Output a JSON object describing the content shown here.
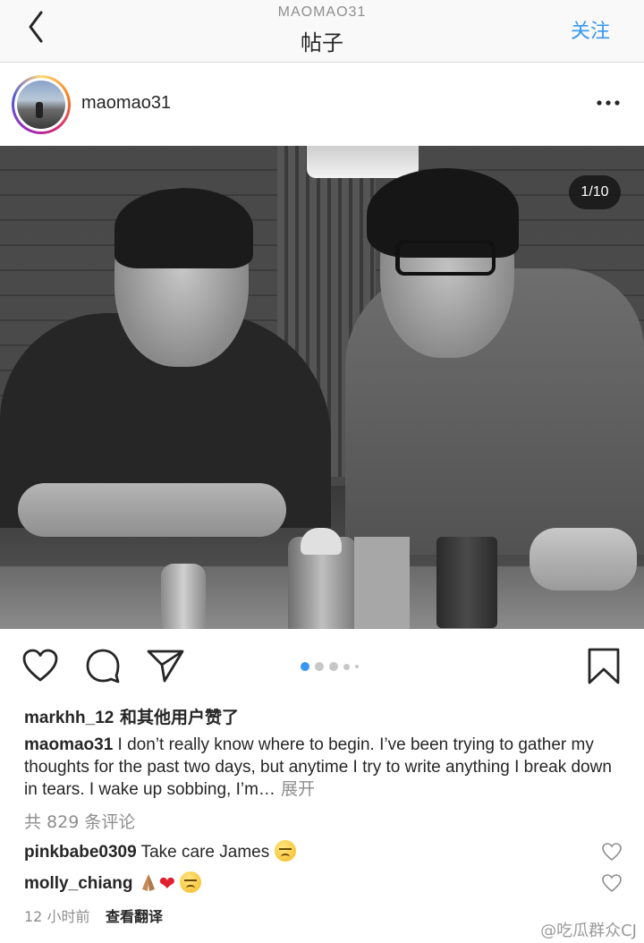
{
  "nav": {
    "subtitle": "MAOMAO31",
    "title": "帖子",
    "follow_label": "关注",
    "back_icon": "chevron-left-icon"
  },
  "post": {
    "username": "maomao31",
    "more_icon": "more-horizontal-icon",
    "image_counter": "1/10",
    "carousel_total": 5,
    "carousel_active": 1
  },
  "actions": {
    "like_icon": "heart-icon",
    "comment_icon": "comment-icon",
    "share_icon": "send-icon",
    "save_icon": "bookmark-icon"
  },
  "likes": {
    "user": "markhh_12",
    "suffix": " 和其他用户赞了"
  },
  "caption": {
    "user": "maomao31",
    "text": " I don’t really know where to begin. I’ve been trying to gather my thoughts for the past two days, but anytime I try to write anything I break down in tears. I wake up sobbing, I’m…",
    "more_label": " 展开"
  },
  "comments_count_label": "共 829 条评论",
  "comments": [
    {
      "user": "pinkbabe0309",
      "text": " Take care James "
    },
    {
      "user": "molly_chiang",
      "text": " "
    }
  ],
  "timestamp": "12 小时前",
  "translate_label": "查看翻译",
  "watermark": "@吃瓜群众CJ",
  "colors": {
    "accent": "#3897f0",
    "muted": "#8e8e8e",
    "text": "#262626"
  }
}
